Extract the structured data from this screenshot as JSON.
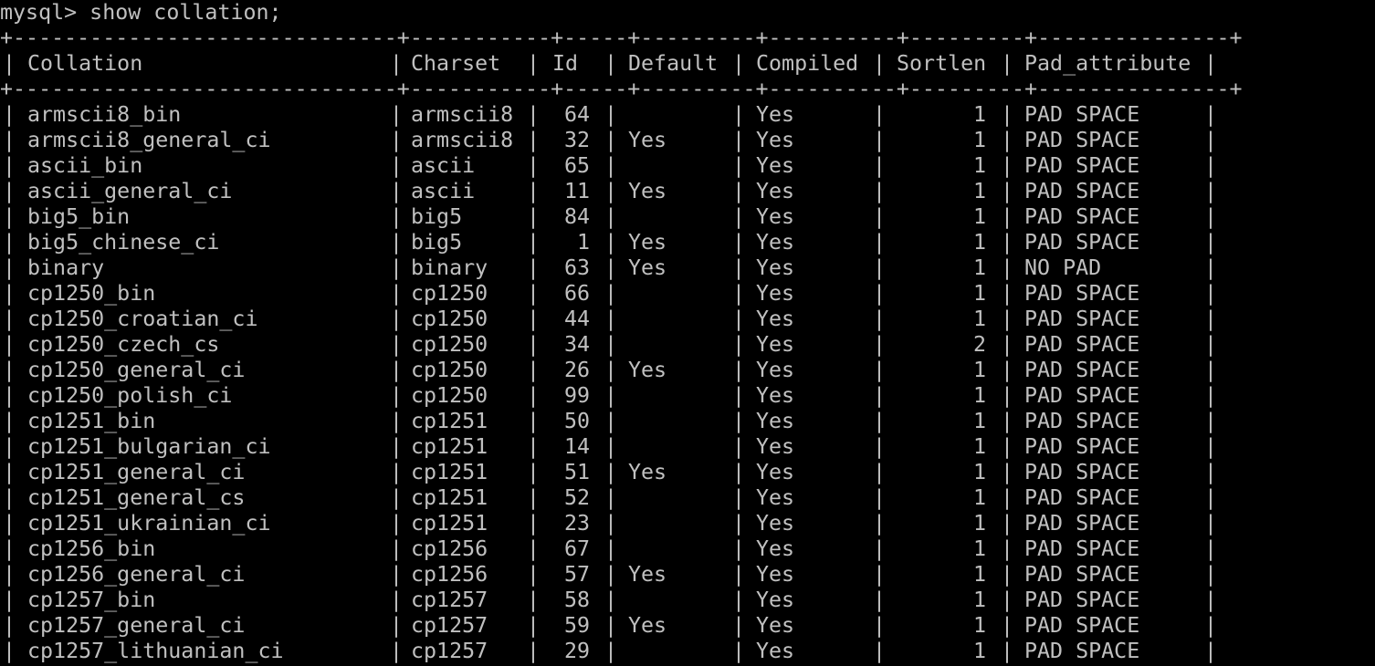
{
  "terminal": {
    "prompt": "mysql> show collation;",
    "border": "+------------------------------+-----------+-----+---------+----------+---------+---------------+",
    "pipe": "|",
    "headers": [
      "Collation",
      "Charset",
      "Id",
      "Default",
      "Compiled",
      "Sortlen",
      "Pad_attribute"
    ],
    "rows": [
      {
        "collation": "armscii8_bin",
        "charset": "armscii8",
        "id": "64",
        "default": "",
        "compiled": "Yes",
        "sortlen": "1",
        "pad": "PAD SPACE"
      },
      {
        "collation": "armscii8_general_ci",
        "charset": "armscii8",
        "id": "32",
        "default": "Yes",
        "compiled": "Yes",
        "sortlen": "1",
        "pad": "PAD SPACE"
      },
      {
        "collation": "ascii_bin",
        "charset": "ascii",
        "id": "65",
        "default": "",
        "compiled": "Yes",
        "sortlen": "1",
        "pad": "PAD SPACE"
      },
      {
        "collation": "ascii_general_ci",
        "charset": "ascii",
        "id": "11",
        "default": "Yes",
        "compiled": "Yes",
        "sortlen": "1",
        "pad": "PAD SPACE"
      },
      {
        "collation": "big5_bin",
        "charset": "big5",
        "id": "84",
        "default": "",
        "compiled": "Yes",
        "sortlen": "1",
        "pad": "PAD SPACE"
      },
      {
        "collation": "big5_chinese_ci",
        "charset": "big5",
        "id": "1",
        "default": "Yes",
        "compiled": "Yes",
        "sortlen": "1",
        "pad": "PAD SPACE"
      },
      {
        "collation": "binary",
        "charset": "binary",
        "id": "63",
        "default": "Yes",
        "compiled": "Yes",
        "sortlen": "1",
        "pad": "NO PAD"
      },
      {
        "collation": "cp1250_bin",
        "charset": "cp1250",
        "id": "66",
        "default": "",
        "compiled": "Yes",
        "sortlen": "1",
        "pad": "PAD SPACE"
      },
      {
        "collation": "cp1250_croatian_ci",
        "charset": "cp1250",
        "id": "44",
        "default": "",
        "compiled": "Yes",
        "sortlen": "1",
        "pad": "PAD SPACE"
      },
      {
        "collation": "cp1250_czech_cs",
        "charset": "cp1250",
        "id": "34",
        "default": "",
        "compiled": "Yes",
        "sortlen": "2",
        "pad": "PAD SPACE"
      },
      {
        "collation": "cp1250_general_ci",
        "charset": "cp1250",
        "id": "26",
        "default": "Yes",
        "compiled": "Yes",
        "sortlen": "1",
        "pad": "PAD SPACE"
      },
      {
        "collation": "cp1250_polish_ci",
        "charset": "cp1250",
        "id": "99",
        "default": "",
        "compiled": "Yes",
        "sortlen": "1",
        "pad": "PAD SPACE"
      },
      {
        "collation": "cp1251_bin",
        "charset": "cp1251",
        "id": "50",
        "default": "",
        "compiled": "Yes",
        "sortlen": "1",
        "pad": "PAD SPACE"
      },
      {
        "collation": "cp1251_bulgarian_ci",
        "charset": "cp1251",
        "id": "14",
        "default": "",
        "compiled": "Yes",
        "sortlen": "1",
        "pad": "PAD SPACE"
      },
      {
        "collation": "cp1251_general_ci",
        "charset": "cp1251",
        "id": "51",
        "default": "Yes",
        "compiled": "Yes",
        "sortlen": "1",
        "pad": "PAD SPACE"
      },
      {
        "collation": "cp1251_general_cs",
        "charset": "cp1251",
        "id": "52",
        "default": "",
        "compiled": "Yes",
        "sortlen": "1",
        "pad": "PAD SPACE"
      },
      {
        "collation": "cp1251_ukrainian_ci",
        "charset": "cp1251",
        "id": "23",
        "default": "",
        "compiled": "Yes",
        "sortlen": "1",
        "pad": "PAD SPACE"
      },
      {
        "collation": "cp1256_bin",
        "charset": "cp1256",
        "id": "67",
        "default": "",
        "compiled": "Yes",
        "sortlen": "1",
        "pad": "PAD SPACE"
      },
      {
        "collation": "cp1256_general_ci",
        "charset": "cp1256",
        "id": "57",
        "default": "Yes",
        "compiled": "Yes",
        "sortlen": "1",
        "pad": "PAD SPACE"
      },
      {
        "collation": "cp1257_bin",
        "charset": "cp1257",
        "id": "58",
        "default": "",
        "compiled": "Yes",
        "sortlen": "1",
        "pad": "PAD SPACE"
      },
      {
        "collation": "cp1257_general_ci",
        "charset": "cp1257",
        "id": "59",
        "default": "Yes",
        "compiled": "Yes",
        "sortlen": "1",
        "pad": "PAD SPACE"
      },
      {
        "collation": "cp1257_lithuanian_ci",
        "charset": "cp1257",
        "id": "29",
        "default": "",
        "compiled": "Yes",
        "sortlen": "1",
        "pad": "PAD SPACE"
      }
    ]
  },
  "colors": {
    "background": "#000000",
    "text": "#c0c0c0"
  }
}
